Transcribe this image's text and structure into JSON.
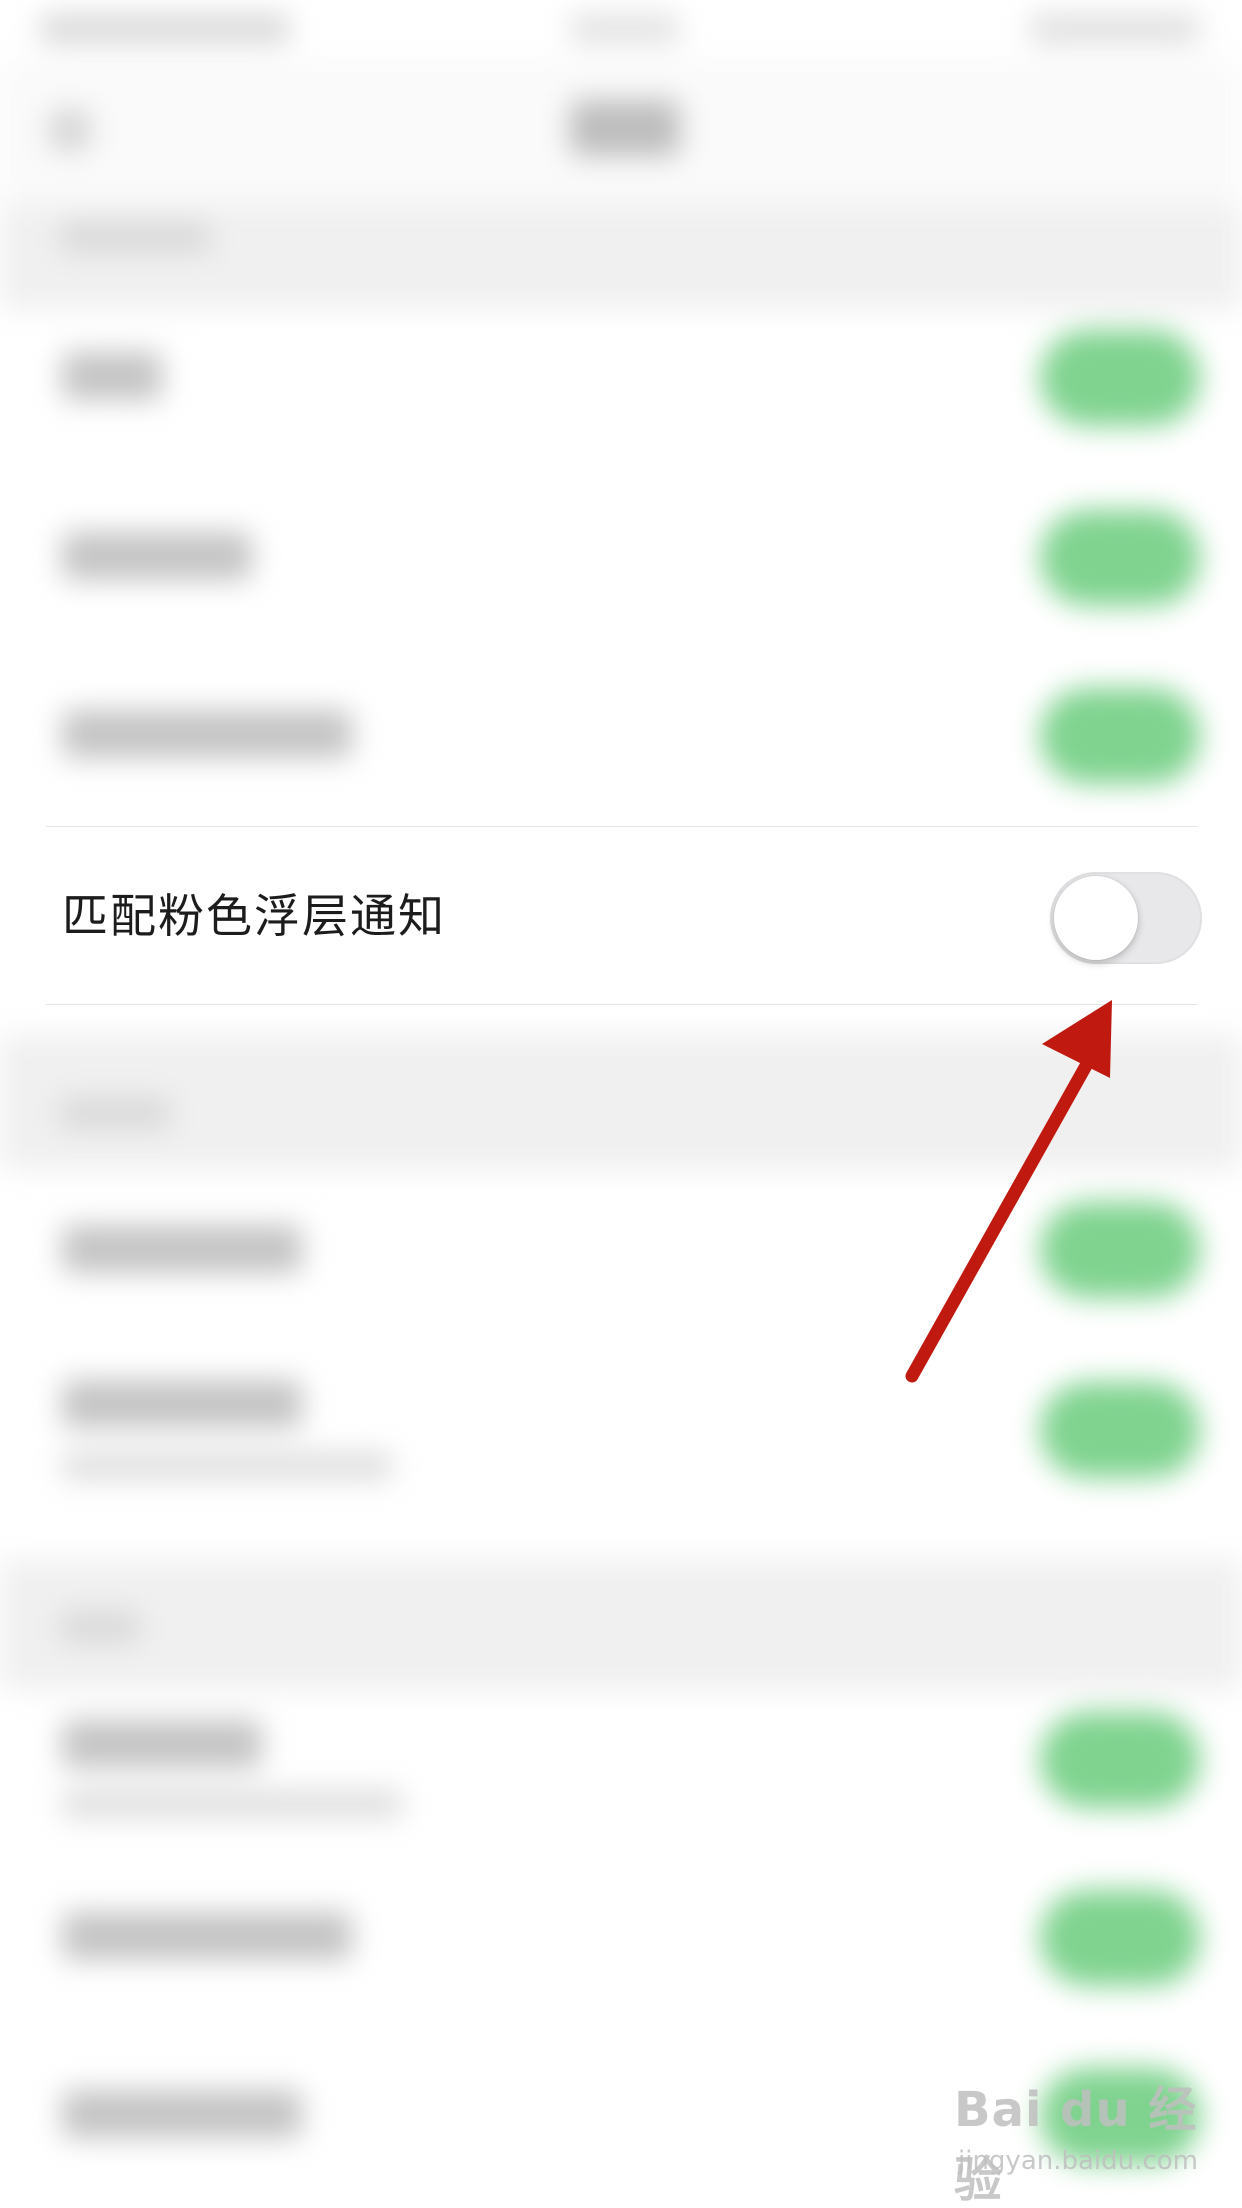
{
  "setting_row": {
    "label": "匹配粉色浮层通知",
    "toggle_state": "off"
  },
  "watermark": {
    "brand": "Bai du 经验",
    "url": "jingyan.baidu.com"
  },
  "colors": {
    "toggle_on": "#7fd38f",
    "toggle_off": "#e8e8ea",
    "arrow": "#c0190f"
  },
  "icons": [
    "arrow-annotation-icon"
  ]
}
